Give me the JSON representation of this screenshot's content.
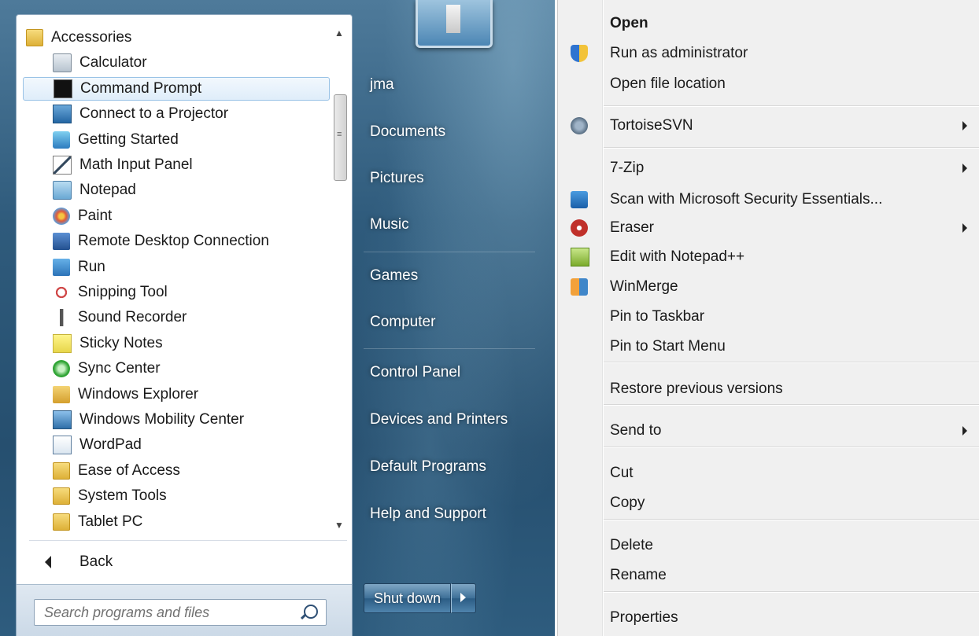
{
  "start_menu": {
    "programs": [
      {
        "label": "Accessories",
        "icon": "folder-icon",
        "top": true
      },
      {
        "label": "Calculator",
        "icon": "calculator-icon"
      },
      {
        "label": "Command Prompt",
        "icon": "command-prompt-icon",
        "selected": true
      },
      {
        "label": "Connect to a Projector",
        "icon": "projector-icon"
      },
      {
        "label": "Getting Started",
        "icon": "getting-started-icon"
      },
      {
        "label": "Math Input Panel",
        "icon": "math-input-icon"
      },
      {
        "label": "Notepad",
        "icon": "notepad-icon"
      },
      {
        "label": "Paint",
        "icon": "paint-icon"
      },
      {
        "label": "Remote Desktop Connection",
        "icon": "remote-desktop-icon"
      },
      {
        "label": "Run",
        "icon": "run-icon"
      },
      {
        "label": "Snipping Tool",
        "icon": "snipping-tool-icon"
      },
      {
        "label": "Sound Recorder",
        "icon": "microphone-icon"
      },
      {
        "label": "Sticky Notes",
        "icon": "sticky-notes-icon"
      },
      {
        "label": "Sync Center",
        "icon": "sync-center-icon"
      },
      {
        "label": "Windows Explorer",
        "icon": "folder-explorer-icon"
      },
      {
        "label": "Windows Mobility Center",
        "icon": "mobility-center-icon"
      },
      {
        "label": "WordPad",
        "icon": "wordpad-icon"
      },
      {
        "label": "Ease of Access",
        "icon": "folder-icon"
      },
      {
        "label": "System Tools",
        "icon": "folder-icon"
      },
      {
        "label": "Tablet PC",
        "icon": "folder-icon"
      }
    ],
    "back_label": "Back",
    "search_placeholder": "Search programs and files",
    "user_name": "jma",
    "right_links": [
      "Documents",
      "Pictures",
      "Music",
      "Games",
      "Computer",
      "Control Panel",
      "Devices and Printers",
      "Default Programs",
      "Help and Support"
    ],
    "shutdown_label": "Shut down"
  },
  "context_menu": {
    "items": [
      {
        "label": "Open",
        "bold": true
      },
      {
        "label": "Run as administrator",
        "icon": "shield-icon"
      },
      {
        "label": "Open file location"
      },
      {
        "label": "TortoiseSVN",
        "icon": "tortoisesvn-icon",
        "submenu": true
      },
      {
        "label": "7-Zip",
        "submenu": true
      },
      {
        "label": "Scan with Microsoft Security Essentials...",
        "icon": "security-essentials-icon"
      },
      {
        "label": "Eraser",
        "icon": "eraser-icon",
        "submenu": true
      },
      {
        "label": "Edit with Notepad++",
        "icon": "notepad-plus-icon"
      },
      {
        "label": "WinMerge",
        "icon": "winmerge-icon"
      },
      {
        "label": "Pin to Taskbar"
      },
      {
        "label": "Pin to Start Menu"
      },
      {
        "label": "Restore previous versions"
      },
      {
        "label": "Send to",
        "submenu": true
      },
      {
        "label": "Cut"
      },
      {
        "label": "Copy"
      },
      {
        "label": "Delete"
      },
      {
        "label": "Rename"
      },
      {
        "label": "Properties"
      }
    ]
  },
  "colors": {
    "selection_border": "#99c2e6",
    "menu_bg": "#f0f0f0",
    "start_blue": "#2f5b7c"
  }
}
